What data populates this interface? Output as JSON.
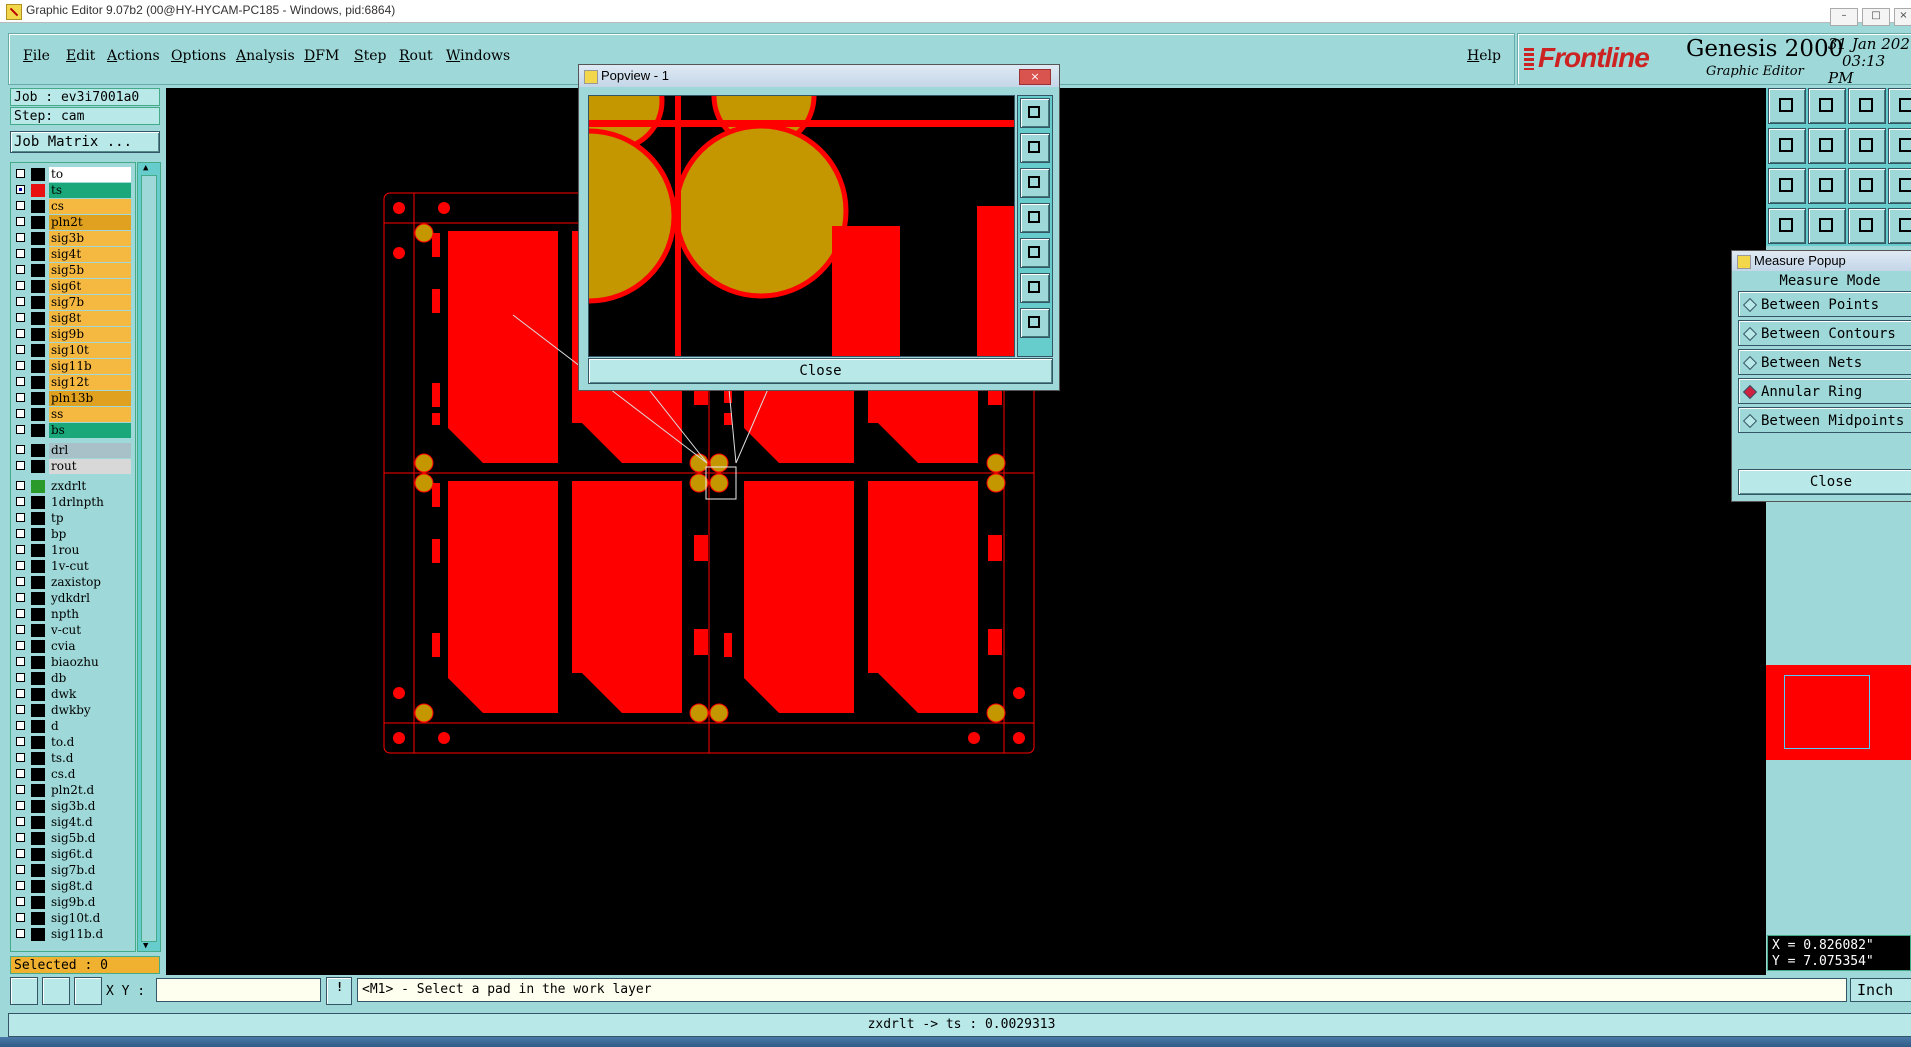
{
  "window": {
    "title": "Graphic Editor 9.07b2 (00@HY-HYCAM-PC185 - Windows, pid:6864)"
  },
  "menu": {
    "items": [
      "File",
      "Edit",
      "Actions",
      "Options",
      "Analysis",
      "DFM",
      "Step",
      "Rout",
      "Windows"
    ],
    "help": "Help"
  },
  "brand": {
    "logo": "Frontline",
    "product": "Genesis 2000",
    "subtitle": "Graphic Editor",
    "date": "31 Jan 202",
    "time": "03:13 PM"
  },
  "job": {
    "job_label": "Job : ev3i7001a0",
    "step_label": "Step: cam",
    "matrix_button": "Job Matrix ..."
  },
  "layers": [
    {
      "name": "to",
      "color": "#ffffff",
      "swatch": "#000000",
      "checked": false
    },
    {
      "name": "ts",
      "color": "#1aa87a",
      "swatch": "#e81010",
      "checked": true
    },
    {
      "name": "cs",
      "color": "#f5b840",
      "swatch": "#000000",
      "checked": false
    },
    {
      "name": "pln2t",
      "color": "#e0a020",
      "swatch": "#000000",
      "checked": false
    },
    {
      "name": "sig3b",
      "color": "#f5b840",
      "swatch": "#000000",
      "checked": false
    },
    {
      "name": "sig4t",
      "color": "#f5b840",
      "swatch": "#000000",
      "checked": false
    },
    {
      "name": "sig5b",
      "color": "#f5b840",
      "swatch": "#000000",
      "checked": false
    },
    {
      "name": "sig6t",
      "color": "#f5b840",
      "swatch": "#000000",
      "checked": false
    },
    {
      "name": "sig7b",
      "color": "#f5b840",
      "swatch": "#000000",
      "checked": false
    },
    {
      "name": "sig8t",
      "color": "#f5b840",
      "swatch": "#000000",
      "checked": false
    },
    {
      "name": "sig9b",
      "color": "#f5b840",
      "swatch": "#000000",
      "checked": false
    },
    {
      "name": "sig10t",
      "color": "#f5b840",
      "swatch": "#000000",
      "checked": false
    },
    {
      "name": "sig11b",
      "color": "#f5b840",
      "swatch": "#000000",
      "checked": false
    },
    {
      "name": "sig12t",
      "color": "#f5b840",
      "swatch": "#000000",
      "checked": false
    },
    {
      "name": "pln13b",
      "color": "#e0a020",
      "swatch": "#000000",
      "checked": false
    },
    {
      "name": "ss",
      "color": "#f5b840",
      "swatch": "#000000",
      "checked": false
    },
    {
      "name": "bs",
      "color": "#1aa87a",
      "swatch": "#000000",
      "checked": false
    },
    {
      "name": "drl",
      "color": "#a8c0c8",
      "swatch": "#000000",
      "checked": false,
      "gap": true
    },
    {
      "name": "rout",
      "color": "#d8d8d8",
      "swatch": "#000000",
      "checked": false
    },
    {
      "name": "zxdrlt",
      "color": "#9ed8d8",
      "swatch": "#2a9a2a",
      "checked": false,
      "gap": true
    },
    {
      "name": "1drlnpth",
      "color": "#9ed8d8",
      "swatch": "#000000",
      "checked": false
    },
    {
      "name": "tp",
      "color": "#9ed8d8",
      "swatch": "#000000",
      "checked": false
    },
    {
      "name": "bp",
      "color": "#9ed8d8",
      "swatch": "#000000",
      "checked": false
    },
    {
      "name": "1rou",
      "color": "#9ed8d8",
      "swatch": "#000000",
      "checked": false
    },
    {
      "name": "1v-cut",
      "color": "#9ed8d8",
      "swatch": "#000000",
      "checked": false
    },
    {
      "name": "zaxistop",
      "color": "#9ed8d8",
      "swatch": "#000000",
      "checked": false
    },
    {
      "name": "ydkdrl",
      "color": "#9ed8d8",
      "swatch": "#000000",
      "checked": false
    },
    {
      "name": "npth",
      "color": "#9ed8d8",
      "swatch": "#000000",
      "checked": false
    },
    {
      "name": "v-cut",
      "color": "#9ed8d8",
      "swatch": "#000000",
      "checked": false
    },
    {
      "name": "cvia",
      "color": "#9ed8d8",
      "swatch": "#000000",
      "checked": false
    },
    {
      "name": "biaozhu",
      "color": "#9ed8d8",
      "swatch": "#000000",
      "checked": false
    },
    {
      "name": "db",
      "color": "#9ed8d8",
      "swatch": "#000000",
      "checked": false
    },
    {
      "name": "dwk",
      "color": "#9ed8d8",
      "swatch": "#000000",
      "checked": false
    },
    {
      "name": "dwkby",
      "color": "#9ed8d8",
      "swatch": "#000000",
      "checked": false
    },
    {
      "name": "d",
      "color": "#9ed8d8",
      "swatch": "#000000",
      "checked": false
    },
    {
      "name": "to.d",
      "color": "#9ed8d8",
      "swatch": "#000000",
      "checked": false
    },
    {
      "name": "ts.d",
      "color": "#9ed8d8",
      "swatch": "#000000",
      "checked": false
    },
    {
      "name": "cs.d",
      "color": "#9ed8d8",
      "swatch": "#000000",
      "checked": false
    },
    {
      "name": "pln2t.d",
      "color": "#9ed8d8",
      "swatch": "#000000",
      "checked": false
    },
    {
      "name": "sig3b.d",
      "color": "#9ed8d8",
      "swatch": "#000000",
      "checked": false
    },
    {
      "name": "sig4t.d",
      "color": "#9ed8d8",
      "swatch": "#000000",
      "checked": false
    },
    {
      "name": "sig5b.d",
      "color": "#9ed8d8",
      "swatch": "#000000",
      "checked": false
    },
    {
      "name": "sig6t.d",
      "color": "#9ed8d8",
      "swatch": "#000000",
      "checked": false
    },
    {
      "name": "sig7b.d",
      "color": "#9ed8d8",
      "swatch": "#000000",
      "checked": false
    },
    {
      "name": "sig8t.d",
      "color": "#9ed8d8",
      "swatch": "#000000",
      "checked": false
    },
    {
      "name": "sig9b.d",
      "color": "#9ed8d8",
      "swatch": "#000000",
      "checked": false
    },
    {
      "name": "sig10t.d",
      "color": "#9ed8d8",
      "swatch": "#000000",
      "checked": false
    },
    {
      "name": "sig11b.d",
      "color": "#9ed8d8",
      "swatch": "#000000",
      "checked": false
    }
  ],
  "selected": "Selected : 0",
  "popview": {
    "title": "Popview - 1",
    "close": "Close"
  },
  "measure": {
    "title": "Measure Popup",
    "mode_label": "Measure Mode",
    "options": [
      "Between Points",
      "Between Contours",
      "Between Nets",
      "Annular Ring",
      "Between Midpoints"
    ],
    "selected_option": "Annular Ring",
    "close": "Close"
  },
  "coords": {
    "x": "X = 0.826082\"",
    "y": "Y = 7.075354\""
  },
  "bottom": {
    "xy_label": "X Y :",
    "xy_value": "",
    "prompt": "<M1> - Select a pad in the work layer",
    "unit": "Inch"
  },
  "status": "zxdrlt -> ts : 0.0029313",
  "colors": {
    "background": "#9ed8d8",
    "copper": "#ff0000",
    "pad": "#c49600",
    "canvas": "#000000"
  }
}
